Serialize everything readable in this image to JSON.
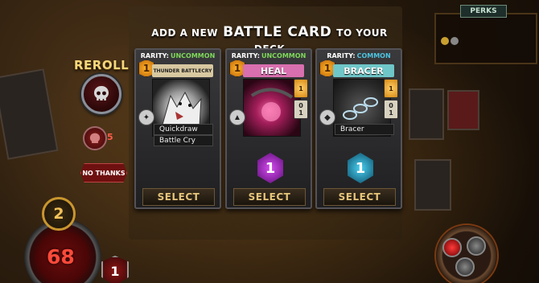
{
  "header": {
    "line1_a": "ADD A NEW",
    "line1_b": "BATTLE CARD",
    "line1_c": "TO YOUR DECK"
  },
  "reroll": {
    "label": "REROLL",
    "cost": "5",
    "no_thanks_label": "NO THANKS"
  },
  "cards": [
    {
      "rarity_label": "RARITY:",
      "rarity": "UNCOMMON",
      "rarity_color": "#7fd85a",
      "energy": "1",
      "title": "THUNDER BATTLECRY",
      "banner_color": "#d8c8a0",
      "abilities": [
        "Quickdraw",
        "Battle Cry"
      ],
      "gems": [],
      "side_icon": "paw-icon",
      "select_label": "SELECT"
    },
    {
      "rarity_label": "RARITY:",
      "rarity": "UNCOMMON",
      "rarity_color": "#7fd85a",
      "energy": "1",
      "title": "HEAL",
      "banner_color": "#d86fae",
      "abilities": [],
      "gems": [
        {
          "top": "1",
          "bottom": "",
          "style": "orange"
        },
        {
          "top": "0",
          "bottom": "1",
          "style": "plain"
        }
      ],
      "side_icon": "triangle-icon",
      "big_cost": "1",
      "big_cost_color": "#9b2fb8",
      "select_label": "SELECT"
    },
    {
      "rarity_label": "RARITY:",
      "rarity": "COMMON",
      "rarity_color": "#4ec3e0",
      "energy": "1",
      "title": "BRACER",
      "banner_color": "#6fc6c8",
      "abilities": [
        "Bracer"
      ],
      "gems": [
        {
          "top": "1",
          "bottom": "",
          "style": "orange"
        },
        {
          "top": "0",
          "bottom": "1",
          "style": "plain"
        }
      ],
      "side_icon": "shield-icon",
      "big_cost": "1",
      "big_cost_color": "#1b8fb0",
      "select_label": "SELECT"
    }
  ],
  "perks": {
    "label": "PERKS"
  },
  "player": {
    "level": "2",
    "health": "68",
    "armor": "1"
  }
}
